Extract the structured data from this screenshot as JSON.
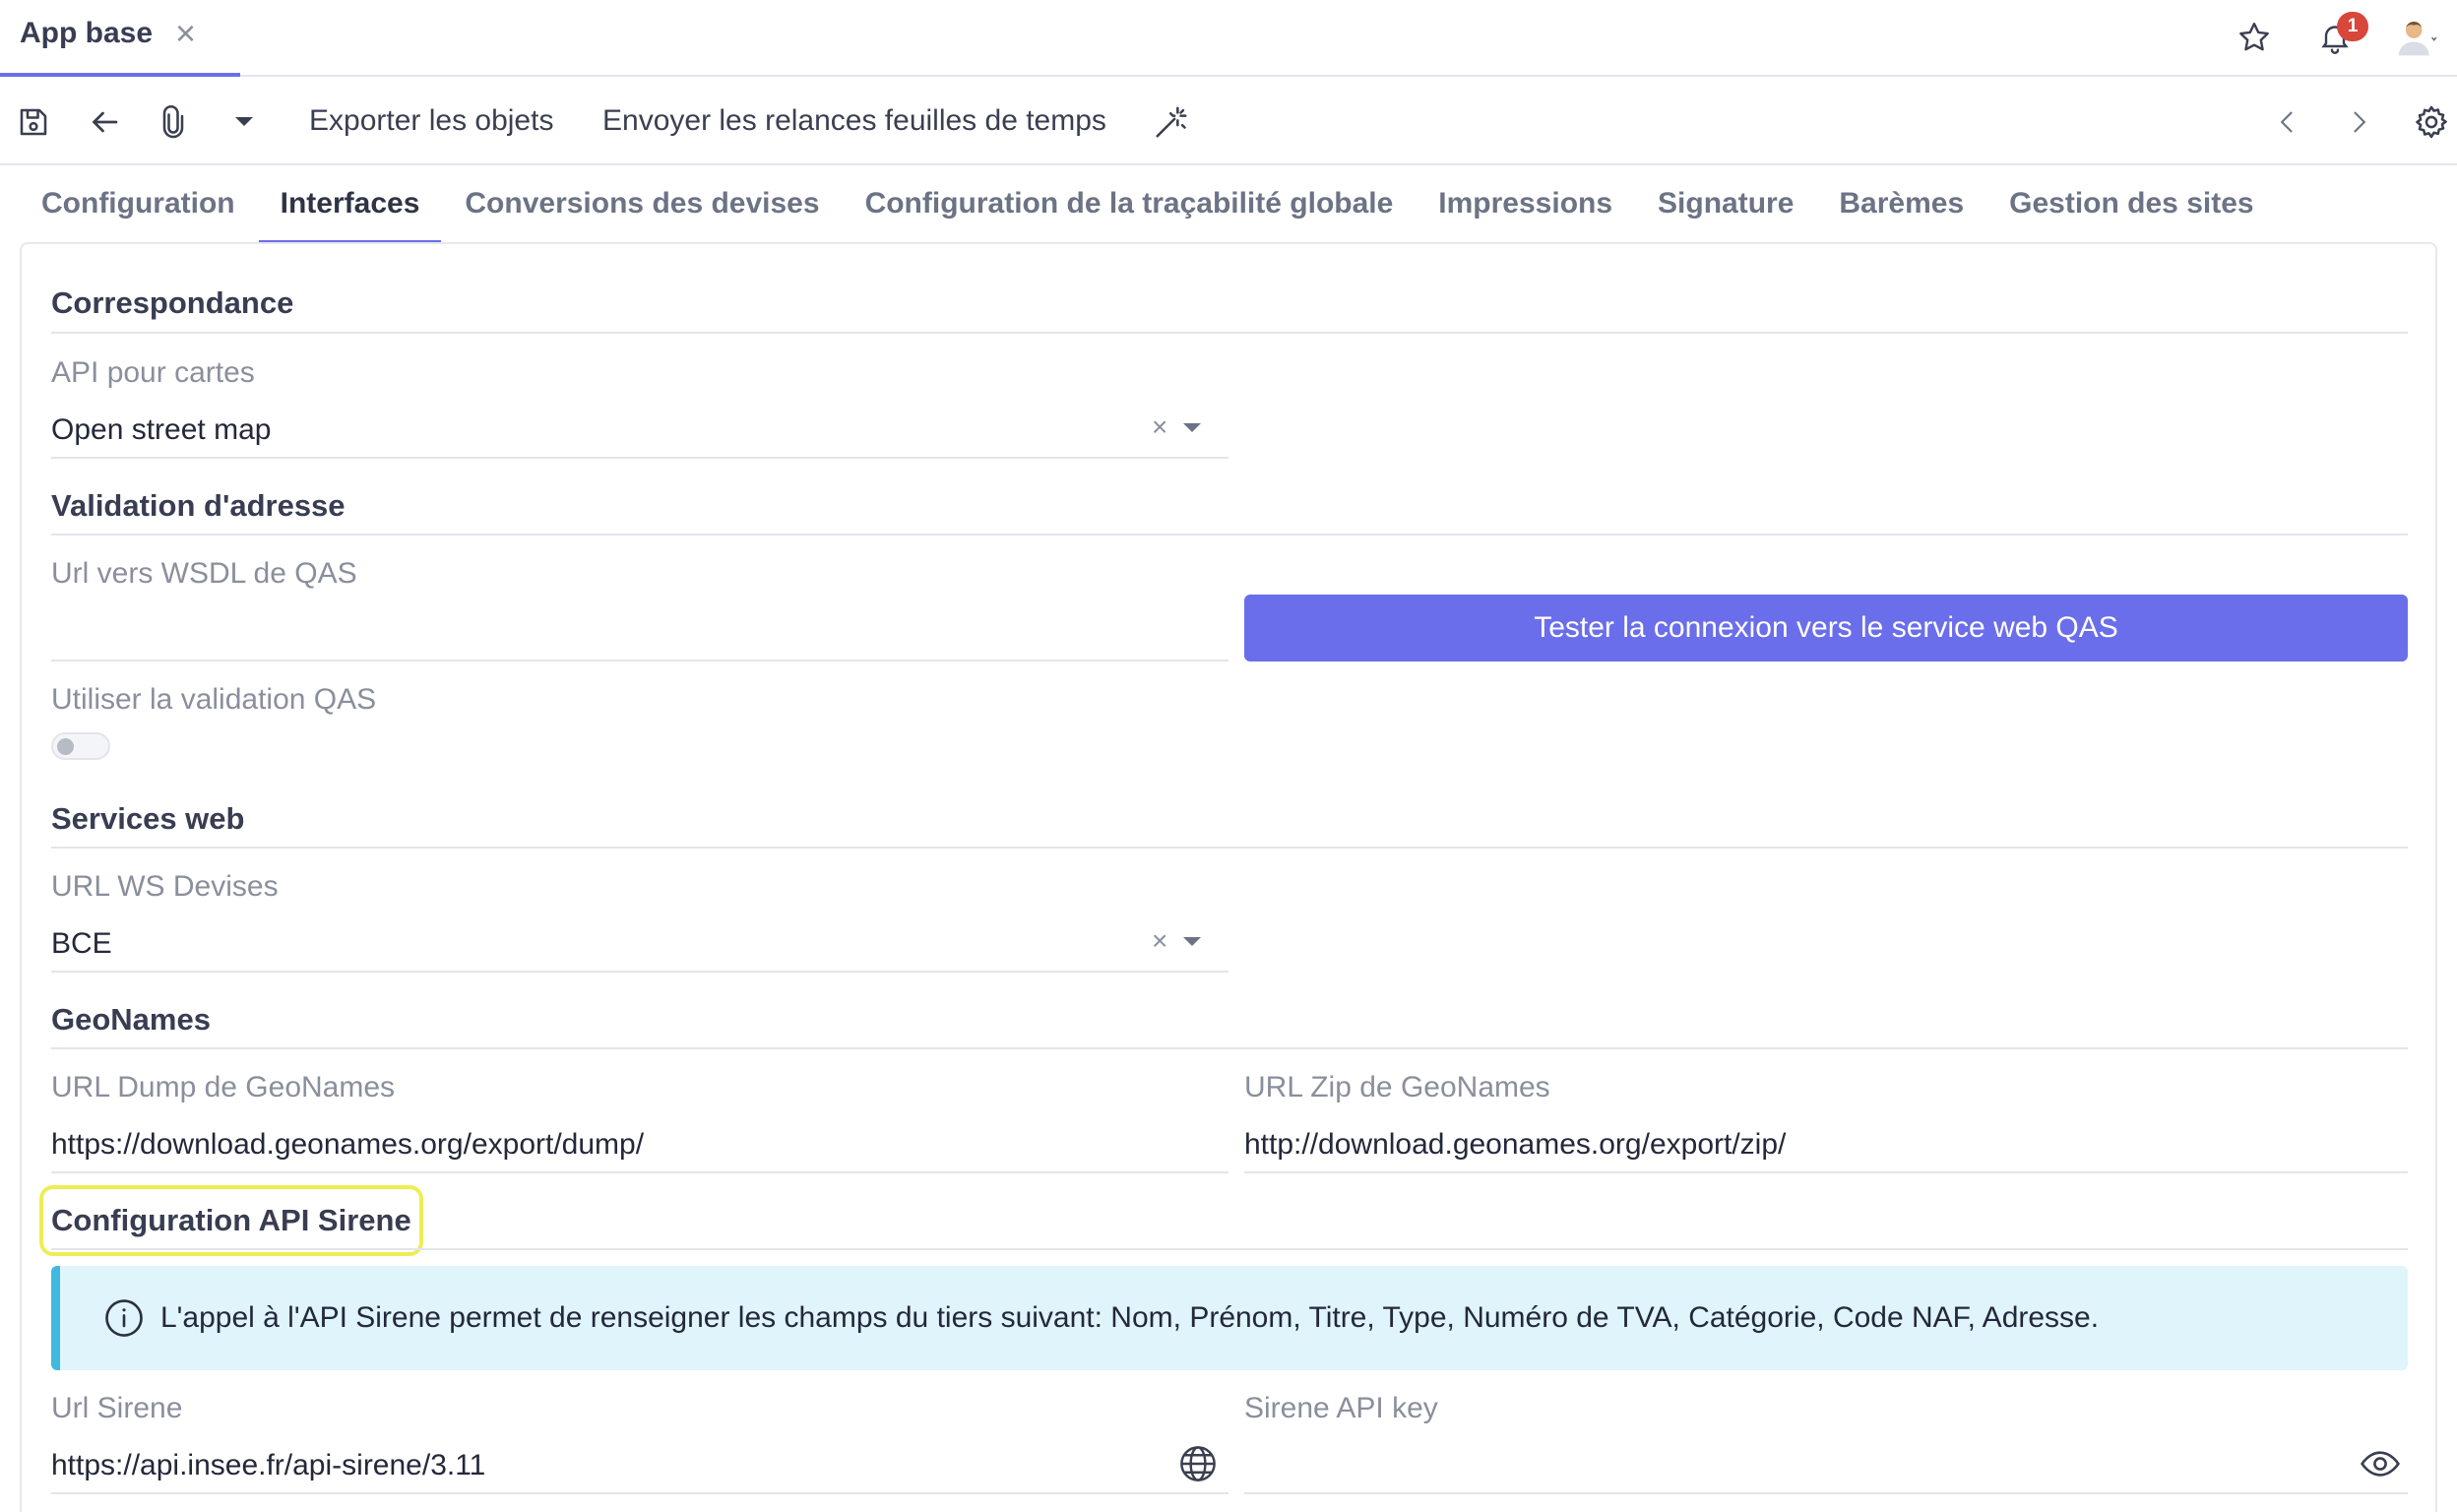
{
  "window": {
    "tab_title": "App base"
  },
  "topbar": {
    "icons": [
      "star-icon",
      "bell-icon",
      "user-avatar-icon"
    ],
    "notification_count": "1"
  },
  "toolbar": {
    "icons": [
      "save-icon",
      "back-arrow-icon",
      "paperclip-icon",
      "caret-down-icon",
      "magic-wand-icon",
      "chevron-left-icon",
      "chevron-right-icon",
      "gear-icon"
    ],
    "export_label": "Exporter les objets",
    "reminder_label": "Envoyer les relances feuilles de temps"
  },
  "tabs": [
    {
      "label": "Configuration",
      "active": false
    },
    {
      "label": "Interfaces",
      "active": true
    },
    {
      "label": "Conversions des devises",
      "active": false
    },
    {
      "label": "Configuration de la traçabilité globale",
      "active": false
    },
    {
      "label": "Impressions",
      "active": false
    },
    {
      "label": "Signature",
      "active": false
    },
    {
      "label": "Barèmes",
      "active": false
    },
    {
      "label": "Gestion des sites",
      "active": false
    }
  ],
  "sections": {
    "correspondance": {
      "title": "Correspondance",
      "map_api_label": "API pour cartes",
      "map_api_value": "Open street map"
    },
    "address_validation": {
      "title": "Validation d'adresse",
      "wsdl_label": "Url vers WSDL de QAS",
      "wsdl_value": "",
      "test_button": "Tester la connexion vers le service web QAS",
      "use_qas_label": "Utiliser la validation QAS",
      "use_qas_enabled": false
    },
    "web_services": {
      "title": "Services web",
      "ws_currency_label": "URL WS Devises",
      "ws_currency_value": "BCE"
    },
    "geonames": {
      "title": "GeoNames",
      "dump_label": "URL Dump de GeoNames",
      "dump_value": "https://download.geonames.org/export/dump/",
      "zip_label": "URL Zip de GeoNames",
      "zip_value": "http://download.geonames.org/export/zip/"
    },
    "sirene": {
      "title": "Configuration API Sirene",
      "info": "L'appel à l'API Sirene permet de renseigner les champs du tiers suivant: Nom, Prénom, Titre, Type, Numéro de TVA, Catégorie, Code NAF, Adresse.",
      "url_label": "Url Sirene",
      "url_value": "https://api.insee.fr/api-sirene/3.11",
      "key_label": "Sirene API key",
      "key_value": ""
    }
  },
  "colors": {
    "accent": "#6b6eea",
    "info_bg": "#dff4fb",
    "info_border": "#40b8e0",
    "highlight": "#eded55",
    "badge": "#d9463a"
  }
}
